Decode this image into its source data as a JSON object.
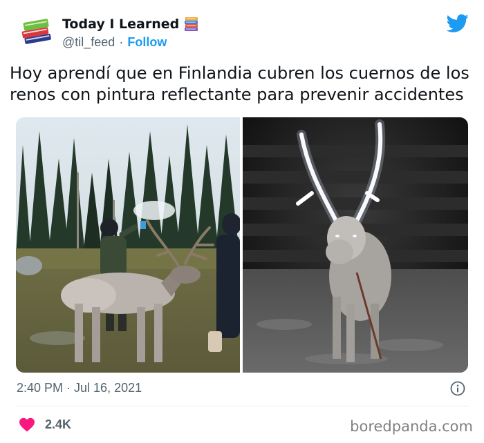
{
  "author": {
    "display_name": "Today I Learned",
    "handle": "@til_feed",
    "separator": "·",
    "follow_label": "Follow",
    "avatar_icon": "stack-of-books-icon",
    "name_emoji": "books-icon"
  },
  "platform_icon": "twitter-bird-icon",
  "tweet_text": "Hoy aprendí que en Finlandia cubren los cuernos de los renos con pintura reflectante para prevenir accidentes",
  "media": [
    {
      "icon": "photo-reindeer-daytime"
    },
    {
      "icon": "photo-reindeer-night-reflective-antlers"
    }
  ],
  "timestamp": "2:40 PM · Jul 16, 2021",
  "info_icon": "info-icon",
  "engagement": {
    "like_icon": "heart-icon",
    "like_count": "2.4K"
  },
  "watermark": "boredpanda.com",
  "colors": {
    "accent": "#1d9bf0",
    "heart": "#f91880",
    "secondary_text": "#536471"
  }
}
